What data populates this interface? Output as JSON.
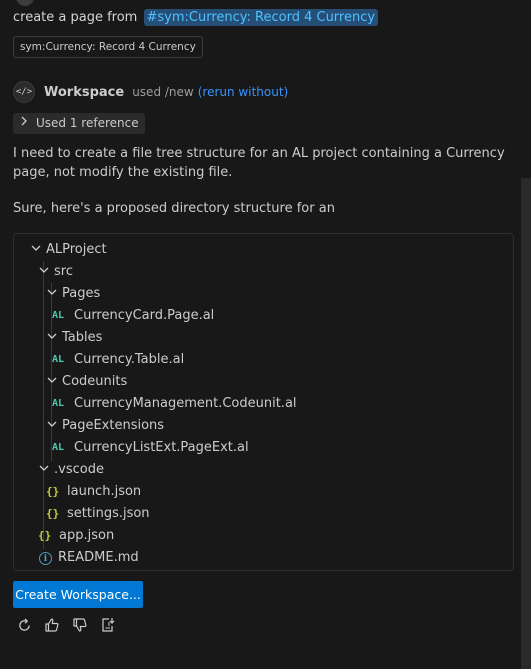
{
  "request": {
    "text": "create a page from",
    "symbol_ref": "#sym:Currency: Record 4 Currency",
    "attachment": "sym:Currency: Record 4 Currency"
  },
  "response_header": {
    "agent": "Workspace",
    "used": "used /new",
    "rerun": "(rerun without)",
    "icon": "code-icon"
  },
  "references": {
    "label": "Used 1 reference",
    "chevron": "chevron-right-icon"
  },
  "messages": {
    "intro": "I need to create a file tree structure for an AL project containing a Currency page, not modify the existing file.",
    "proposal": "Sure, here's a proposed directory structure for an"
  },
  "tree": {
    "root": "ALProject",
    "src": "src",
    "pages": "Pages",
    "currency_card": "CurrencyCard.Page.al",
    "tables": "Tables",
    "currency_table": "Currency.Table.al",
    "codeunits": "Codeunits",
    "currency_mgmt": "CurrencyManagement.Codeunit.al",
    "page_extensions": "PageExtensions",
    "currency_list_ext": "CurrencyListExt.PageExt.al",
    "vscode": ".vscode",
    "launch": "launch.json",
    "settings": "settings.json",
    "app": "app.json",
    "readme": "README.md"
  },
  "icons": {
    "al": "AL",
    "json": "{}",
    "info": "i",
    "chevron_down": "⌄"
  },
  "create_button": "Create Workspace...",
  "actions": [
    "retry-icon",
    "thumbs-up-icon",
    "thumbs-down-icon",
    "insert-icon"
  ],
  "colors": {
    "background": "#181818",
    "accent": "#0078d4",
    "link": "#3794ff",
    "al_icon": "#4ec9b0",
    "json_icon": "#cbcb41",
    "info_icon": "#519aba"
  }
}
